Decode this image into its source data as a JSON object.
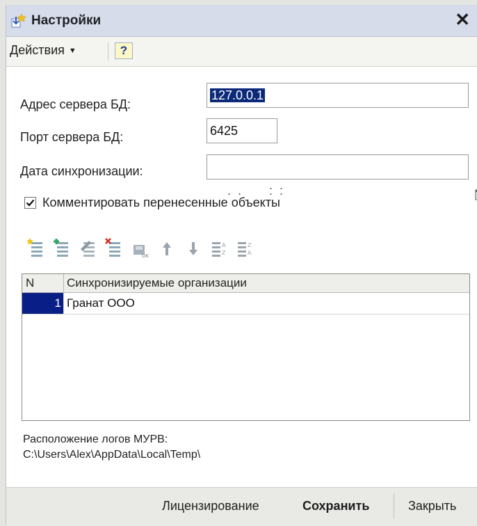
{
  "window": {
    "title": "Настройки",
    "close_glyph": "✕"
  },
  "toolbar": {
    "actions_label": "Действия",
    "help_label": "?"
  },
  "form": {
    "server_address_label": "Адрес сервера БД:",
    "server_address_value": "127.0.0.1",
    "server_port_label": "Порт сервера БД:",
    "server_port_value": "6425",
    "sync_date_label": "Дата синхронизации:",
    "sync_date_value": " .  .        :  :",
    "comment_checkbox_label": "Комментировать перенесенные объекты",
    "comment_checked": true
  },
  "table_toolbar": {
    "icons": [
      "add-row-icon",
      "copy-row-icon",
      "edit-row-icon",
      "delete-row-icon",
      "end-edit-icon",
      "move-up-icon",
      "move-down-icon",
      "sort-asc-icon",
      "sort-desc-icon"
    ]
  },
  "table": {
    "columns": [
      "N",
      "Синхронизируемые организации"
    ],
    "rows": [
      {
        "n": "1",
        "org": "Гранат ООО"
      }
    ]
  },
  "logs": {
    "label": "Расположение логов МУРВ:",
    "path": "C:\\Users\\Alex\\AppData\\Local\\Temp\\"
  },
  "footer": {
    "licensing_label": "Лицензирование",
    "save_label": "Сохранить",
    "close_label": "Закрыть"
  },
  "colors": {
    "titlebar_bg": "#d6dcea",
    "selection_bg": "#0a1f86",
    "help_bg": "#fbf7c6"
  }
}
